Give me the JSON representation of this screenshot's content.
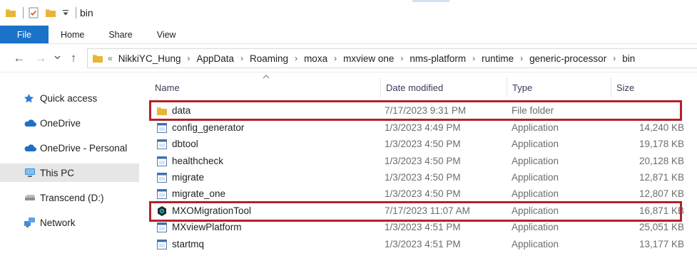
{
  "window": {
    "title": "bin",
    "qat_icons": [
      "folder-icon",
      "properties-icon",
      "new-folder-icon",
      "customize-qat-icon"
    ]
  },
  "ribbon": {
    "tabs": [
      {
        "label": "File",
        "active": true
      },
      {
        "label": "Home"
      },
      {
        "label": "Share"
      },
      {
        "label": "View"
      }
    ],
    "accent": "#1a73c8"
  },
  "nav": {
    "back": "←",
    "forward": "→",
    "recent": "⌄",
    "up": "↑",
    "overflow": "«",
    "breadcrumbs": [
      "NikkiYC_Hung",
      "AppData",
      "Roaming",
      "moxa",
      "mxview one",
      "nms-platform",
      "runtime",
      "generic-processor",
      "bin"
    ]
  },
  "sidebar": {
    "items": [
      {
        "label": "Quick access",
        "icon": "star-icon",
        "selected": false
      },
      {
        "label": "OneDrive",
        "icon": "cloud-icon",
        "selected": false
      },
      {
        "label": "OneDrive - Personal",
        "icon": "cloud-icon",
        "selected": false
      },
      {
        "label": "This PC",
        "icon": "computer-icon",
        "selected": true
      },
      {
        "label": "Transcend (D:)",
        "icon": "drive-icon",
        "selected": false
      },
      {
        "label": "Network",
        "icon": "network-icon",
        "selected": false
      }
    ]
  },
  "columns": {
    "name": "Name",
    "date": "Date modified",
    "type": "Type",
    "size": "Size"
  },
  "files": [
    {
      "name": "data",
      "date": "7/17/2023 9:31 PM",
      "type": "File folder",
      "size": "",
      "icon": "folder-icon",
      "highlighted": true
    },
    {
      "name": "config_generator",
      "date": "1/3/2023 4:49 PM",
      "type": "Application",
      "size": "14,240 KB",
      "icon": "application-icon",
      "highlighted": false
    },
    {
      "name": "dbtool",
      "date": "1/3/2023 4:50 PM",
      "type": "Application",
      "size": "19,178 KB",
      "icon": "application-icon",
      "highlighted": false
    },
    {
      "name": "healthcheck",
      "date": "1/3/2023 4:50 PM",
      "type": "Application",
      "size": "20,128 KB",
      "icon": "application-icon",
      "highlighted": false
    },
    {
      "name": "migrate",
      "date": "1/3/2023 4:50 PM",
      "type": "Application",
      "size": "12,871 KB",
      "icon": "application-icon",
      "highlighted": false
    },
    {
      "name": "migrate_one",
      "date": "1/3/2023 4:50 PM",
      "type": "Application",
      "size": "12,807 KB",
      "icon": "application-icon",
      "highlighted": false
    },
    {
      "name": "MXOMigrationTool",
      "date": "7/17/2023 11:07 AM",
      "type": "Application",
      "size": "16,871 KB",
      "icon": "mxo-app-icon",
      "highlighted": true
    },
    {
      "name": "MXviewPlatform",
      "date": "1/3/2023 4:51 PM",
      "type": "Application",
      "size": "25,051 KB",
      "icon": "application-icon",
      "highlighted": false
    },
    {
      "name": "startmq",
      "date": "1/3/2023 4:51 PM",
      "type": "Application",
      "size": "13,177 KB",
      "icon": "application-icon",
      "highlighted": false
    }
  ],
  "colors": {
    "highlight": "#b3212b",
    "folder": "#f2c347",
    "selected_bg": "#e6e6e6"
  }
}
